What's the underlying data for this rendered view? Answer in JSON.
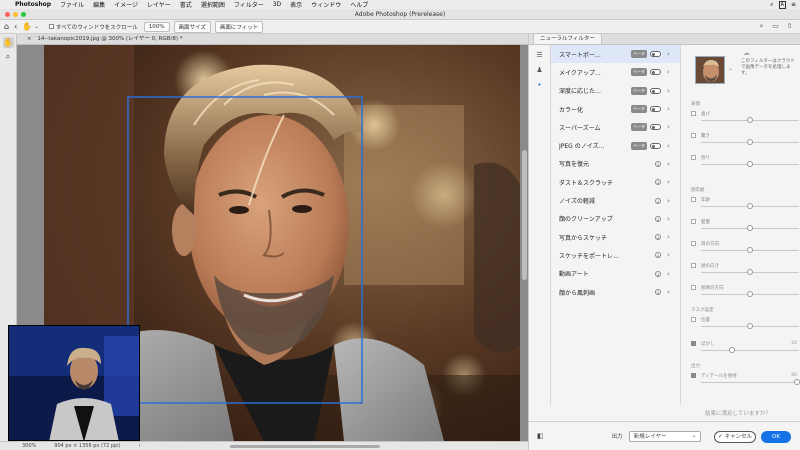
{
  "menubar": {
    "apple": "",
    "app_name": "Photoshop",
    "items": [
      "ファイル",
      "編集",
      "イメージ",
      "レイヤー",
      "書式",
      "選択範囲",
      "フィルター",
      "3D",
      "表示",
      "ウィンドウ",
      "ヘルプ"
    ]
  },
  "window": {
    "title": "Adobe Photoshop (Prerelease)"
  },
  "options": {
    "scroll_all_label": "すべてのウィンドウをスクロール",
    "zoom_100": "100%",
    "fit_screen": "画面サイズ",
    "fill_screen": "画面にフィット"
  },
  "document": {
    "tab_label": "14--takanopic2019.jpg @ 300% (レイヤー 0, RGB/8) *",
    "zoom": "300%",
    "info": "904 px × 1356 px (72 ppi)"
  },
  "neural_panel": {
    "tab_label": "ニューラルフィルター",
    "filters": [
      {
        "name": "スマートポー…",
        "badge": "ベータ",
        "type": "toggle"
      },
      {
        "name": "メイクアップ…",
        "badge": "ベータ",
        "type": "toggle"
      },
      {
        "name": "深度に応じた…",
        "badge": "ベータ",
        "type": "toggle"
      },
      {
        "name": "カラー化",
        "badge": "ベータ",
        "type": "toggle"
      },
      {
        "name": "スーパーズーム",
        "badge": "ベータ",
        "type": "toggle"
      },
      {
        "name": "JPEG のノイズ…",
        "badge": "ベータ",
        "type": "toggle"
      },
      {
        "name": "写真を復元",
        "badge": "",
        "type": "download"
      },
      {
        "name": "ダスト＆スクラッチ",
        "badge": "",
        "type": "download"
      },
      {
        "name": "ノイズの軽減",
        "badge": "",
        "type": "download"
      },
      {
        "name": "顔のクリーンアップ",
        "badge": "",
        "type": "download"
      },
      {
        "name": "写真からスケッチ",
        "badge": "",
        "type": "download"
      },
      {
        "name": "スケッチをポートレ…",
        "badge": "",
        "type": "download"
      },
      {
        "name": "動画アート",
        "badge": "",
        "type": "download"
      },
      {
        "name": "顔から風刺画",
        "badge": "",
        "type": "download"
      }
    ],
    "cloud_note": "このフィルターはクラウドで画像データを処理します。",
    "sections": {
      "expression": "表情",
      "age": "顔年齢",
      "mask": "マスク設定",
      "output_group": "出力"
    },
    "sliders": [
      {
        "label": "喜び",
        "value": 0.5,
        "checked": false
      },
      {
        "label": "驚き",
        "value": 0.5,
        "checked": false
      },
      {
        "label": "怒り",
        "value": 0.5,
        "checked": false
      },
      {
        "label": "年齢",
        "value": 0.5,
        "checked": false
      },
      {
        "label": "髪量",
        "value": 0.5,
        "checked": false
      },
      {
        "label": "目の方向",
        "value": 0.5,
        "checked": false
      },
      {
        "label": "顔の向き",
        "value": 0.5,
        "checked": false
      },
      {
        "label": "照明の方向",
        "value": 0.5,
        "checked": false
      },
      {
        "label": "位置",
        "value": 0.5,
        "checked": false
      },
      {
        "label": "ぼかし",
        "value": 0.32,
        "checked": true,
        "num": "20"
      },
      {
        "label": "ディテールを保持",
        "value": 0.98,
        "checked": true,
        "num": "80"
      }
    ],
    "question": "結果に満足していますか？",
    "output_label": "出力",
    "output_value": "新規レイヤー",
    "cancel_label": "キャンセル",
    "ok_label": "OK"
  }
}
